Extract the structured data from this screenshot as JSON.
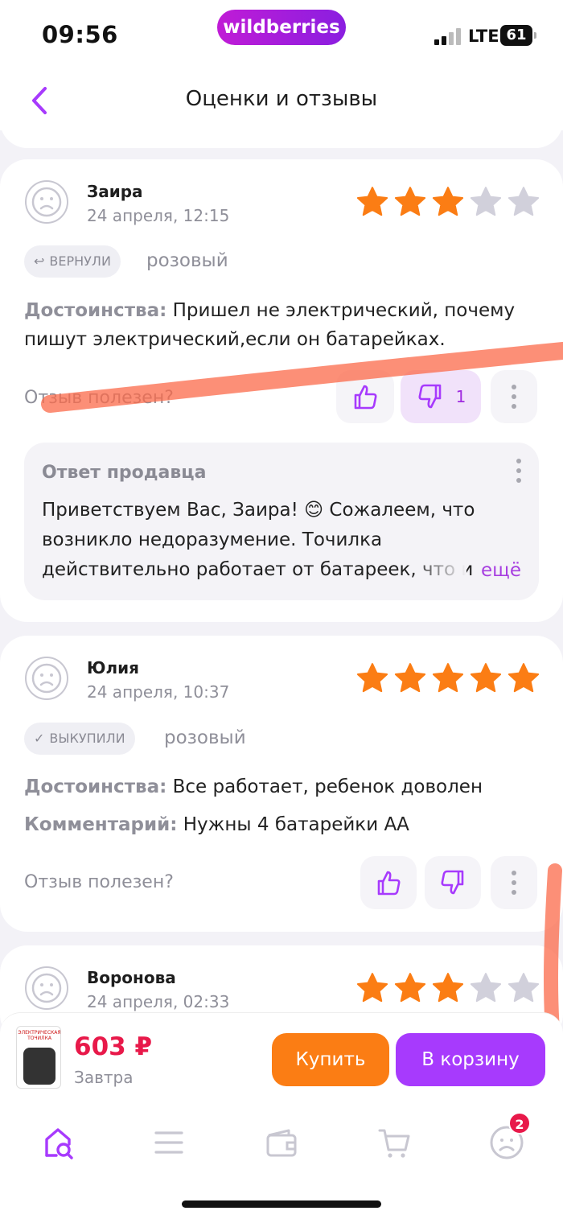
{
  "status": {
    "time": "09:56",
    "network": "LTE",
    "battery": "61"
  },
  "brand": {
    "logo": "wildberries",
    "accent": "#a73afd"
  },
  "nav": {
    "title": "Оценки и отзывы",
    "back_icon": "chevron-left-icon"
  },
  "reviews": [
    {
      "author": "Заира",
      "date": "24 апреля, 12:15",
      "rating": 3,
      "tag": "ВЕРНУЛИ",
      "tag_icon": "↩",
      "variant": "розовый",
      "pros_label": "Достоинства:",
      "pros_text": " Пришел не электрический, почему пишут электрический,если он батарейках.",
      "helpful_label": "Отзыв полезен?",
      "dislikes": "1",
      "reply": {
        "title": "Ответ продавца",
        "text": "Приветствуем Вас, Заира! 😊 Сожалеем, что возникло недоразумение. Точилка действительно работает от батареек, что и",
        "more": "ещё"
      }
    },
    {
      "author": "Юлия",
      "date": "24 апреля, 10:37",
      "rating": 5,
      "tag": "ВЫКУПИЛИ",
      "tag_icon": "✓",
      "variant": "розовый",
      "pros_label": "Достоинства:",
      "pros_text": " Все работает, ребенок доволен",
      "comment_label": "Комментарий:",
      "comment_text": " Нужны 4 батарейки АА",
      "helpful_label": "Отзыв полезен?"
    },
    {
      "author": "Воронова",
      "date": "24 апреля, 02:33",
      "rating": 3
    }
  ],
  "product": {
    "thumb_label": "ЭЛЕКТРИЧЕСКАЯ ТОЧИЛКА",
    "price": "603 ₽",
    "delivery": "Завтра",
    "buy_label": "Купить",
    "cart_label": "В корзину"
  },
  "tabbar": {
    "items": [
      "home-search-icon",
      "catalog-icon",
      "wallet-icon",
      "cart-icon",
      "profile-icon"
    ],
    "profile_badge": "2"
  },
  "colors": {
    "star": "#fb7d14",
    "star_empty": "#d1d0db",
    "price": "#e8194a",
    "buy": "#fb7d14",
    "cart": "#a73afd"
  }
}
